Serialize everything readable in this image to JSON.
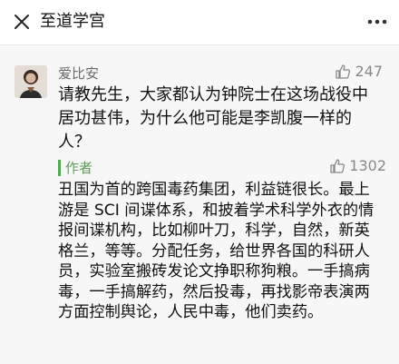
{
  "header": {
    "title": "至道学宫",
    "close_icon": "close-icon",
    "more_icon": "more-dots-icon"
  },
  "comment": {
    "user_name": "爱比安",
    "likes": "247",
    "text": "请教先生，大家都认为钟院士在这场战役中居功甚伟，为什么他可能是李凯腹一样的人？"
  },
  "reply": {
    "author_label": "作者",
    "likes": "1302",
    "text": "丑国为首的跨国毒药集团，利益链很长。最上游是 SCI 间谍体系，和披着学术科学外衣的情报间谍机构，比如柳叶刀，科学，自然，新英格兰，等等。分配任务，给世界各国的科研人员，实验室搬砖发论文挣职称狗粮。一手搞病毒，一手搞解药，然后投毒，再找影帝表演两方面控制舆论，人民中毒，他们卖药。"
  },
  "colors": {
    "accent": "#42b341",
    "author_label": "#5f9d5a",
    "content_bg": "#f7f7f7"
  }
}
